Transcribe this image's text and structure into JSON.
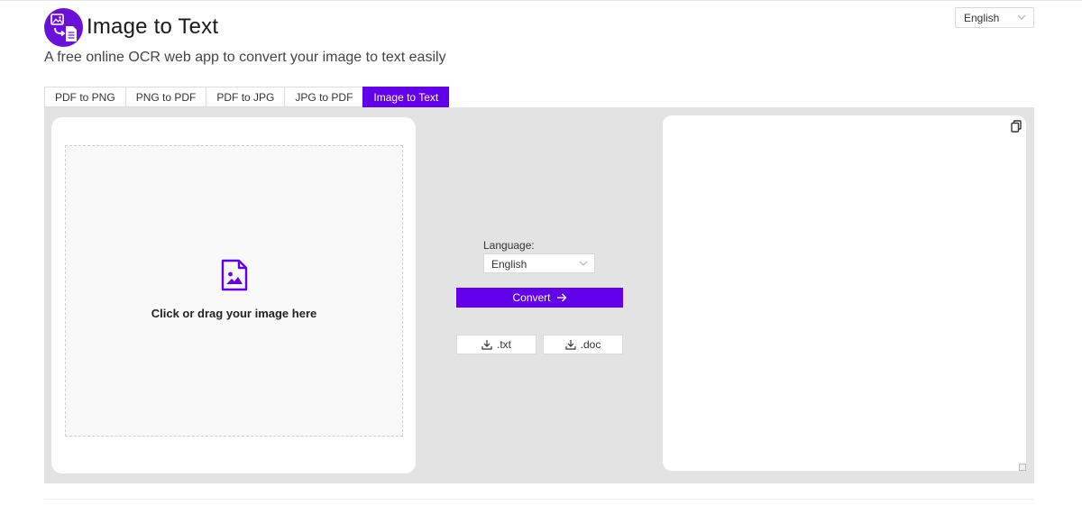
{
  "header": {
    "title": "Image to Text",
    "subtitle": "A free online OCR web app to convert your image to text easily",
    "logo_icon": "image-to-document-icon",
    "brand_color": "#6200ea"
  },
  "site_language": {
    "selected": "English"
  },
  "tabs": [
    {
      "label": "PDF to PNG",
      "active": false
    },
    {
      "label": "PNG to PDF",
      "active": false
    },
    {
      "label": "PDF to JPG",
      "active": false
    },
    {
      "label": "JPG to PDF",
      "active": false
    },
    {
      "label": "Image to Text",
      "active": true
    }
  ],
  "upload": {
    "label": "Click or drag your image here",
    "icon": "image-file-icon"
  },
  "controls": {
    "language_label": "Language:",
    "language_selected": "English",
    "convert_label": "Convert",
    "download_txt": ".txt",
    "download_doc": ".doc"
  },
  "output": {
    "copy_icon": "copy-icon"
  }
}
